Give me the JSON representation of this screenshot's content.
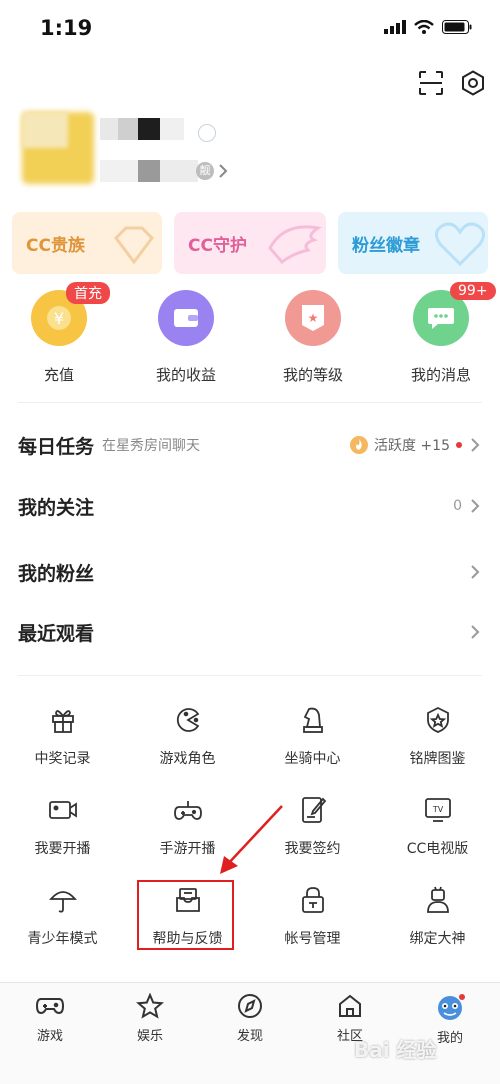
{
  "status": {
    "time": "1:19"
  },
  "profile": {
    "badge": "靓"
  },
  "banners": [
    {
      "label": "CC贵族",
      "color": "#e0953a",
      "bg": "#fff0dd"
    },
    {
      "label": "CC守护",
      "color": "#e0609a",
      "bg": "#ffe7f2"
    },
    {
      "label": "粉丝徽章",
      "color": "#2d9bd6",
      "bg": "#e4f4fd"
    }
  ],
  "quick": [
    {
      "label": "充值",
      "icon": "yuan-coin-icon",
      "badge": "首充"
    },
    {
      "label": "我的收益",
      "icon": "wallet-icon"
    },
    {
      "label": "我的等级",
      "icon": "level-star-icon"
    },
    {
      "label": "我的消息",
      "icon": "chat-bubble-icon",
      "badge": "99+"
    }
  ],
  "list": {
    "daily": {
      "title": "每日任务",
      "sub": "在星秀房间聊天",
      "reward": "活跃度 +15"
    },
    "follow": {
      "title": "我的关注",
      "count": "0"
    },
    "fans": {
      "title": "我的粉丝"
    },
    "recent": {
      "title": "最近观看"
    }
  },
  "tools": [
    {
      "label": "中奖记录",
      "icon": "gift-icon"
    },
    {
      "label": "游戏角色",
      "icon": "pacman-icon"
    },
    {
      "label": "坐骑中心",
      "icon": "horse-chess-icon"
    },
    {
      "label": "铭牌图鉴",
      "icon": "shield-star-icon"
    },
    {
      "label": "我要开播",
      "icon": "video-camera-icon"
    },
    {
      "label": "手游开播",
      "icon": "gamepad-icon"
    },
    {
      "label": "我要签约",
      "icon": "contract-pen-icon"
    },
    {
      "label": "CC电视版",
      "icon": "tv-icon"
    },
    {
      "label": "青少年模式",
      "icon": "umbrella-icon"
    },
    {
      "label": "帮助与反馈",
      "icon": "help-inbox-icon"
    },
    {
      "label": "帐号管理",
      "icon": "lock-icon"
    },
    {
      "label": "绑定大神",
      "icon": "robot-person-icon"
    }
  ],
  "tabs": [
    {
      "label": "游戏",
      "icon": "gamepad-icon"
    },
    {
      "label": "娱乐",
      "icon": "star-icon"
    },
    {
      "label": "发现",
      "icon": "compass-icon"
    },
    {
      "label": "社区",
      "icon": "home-icon"
    },
    {
      "label": "我的",
      "icon": "avatar-icon"
    }
  ],
  "watermark": "Bai 经验"
}
